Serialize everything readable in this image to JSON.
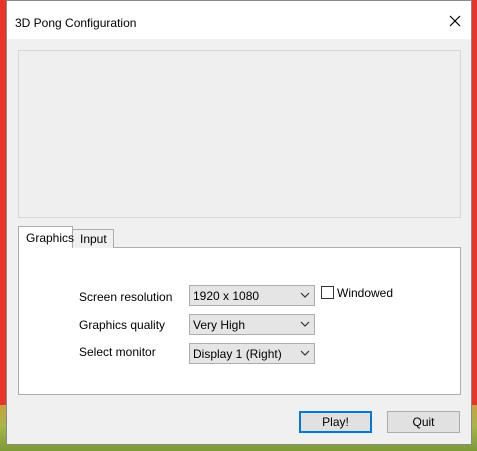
{
  "window": {
    "title": "3D Pong Configuration",
    "close_icon": "close-icon"
  },
  "tabs": [
    {
      "label": "Graphics",
      "selected": true
    },
    {
      "label": "Input",
      "selected": false
    }
  ],
  "graphics": {
    "screen_resolution": {
      "label": "Screen resolution",
      "value": "1920 x 1080"
    },
    "graphics_quality": {
      "label": "Graphics quality",
      "value": "Very High"
    },
    "select_monitor": {
      "label": "Select monitor",
      "value": "Display 1 (Right)"
    },
    "windowed": {
      "label": "Windowed",
      "checked": false
    }
  },
  "buttons": {
    "play": "Play!",
    "quit": "Quit"
  },
  "colors": {
    "accent": "#0078d7",
    "desktop_bg": "#e8352c"
  }
}
